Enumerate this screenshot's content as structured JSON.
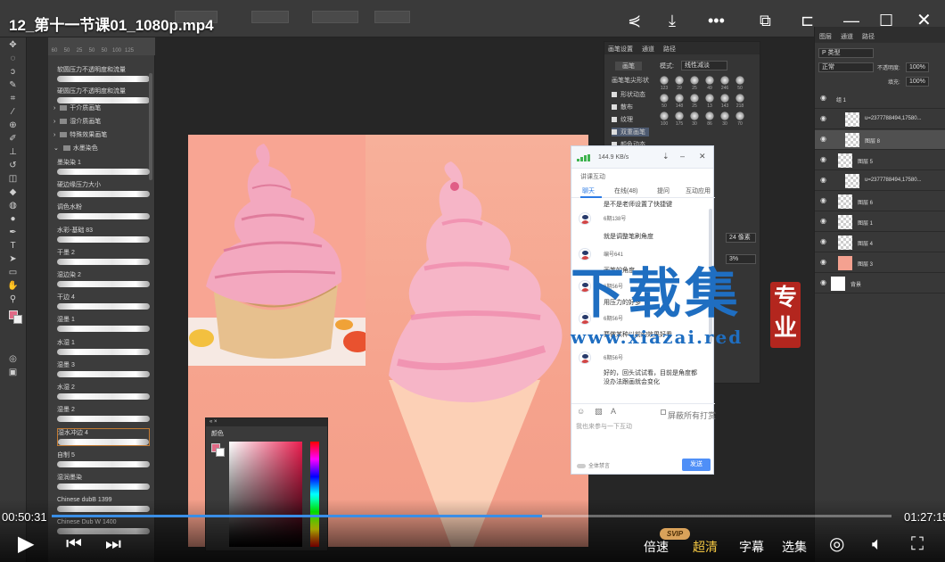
{
  "video": {
    "title": "12_第十一节课01_1080p.mp4",
    "current_time": "00:50:31",
    "total_time": "01:27:15",
    "progress": 0.584,
    "speed_label": "倍速",
    "quality_label": "超清",
    "subtitle_label": "字幕",
    "episodes_label": "选集",
    "svip_badge": "SVIP"
  },
  "photoshop": {
    "brush_sizes": [
      "60",
      "50",
      "25",
      "50",
      "50",
      "100",
      "125"
    ],
    "brushes": [
      {
        "name": "软圆压力不透明度和流量"
      },
      {
        "name": "硬圆压力不透明度和流量"
      }
    ],
    "folders": [
      {
        "name": "干介质画笔"
      },
      {
        "name": "湿介质画笔"
      },
      {
        "name": "特殊效果画笔"
      },
      {
        "name": "水墨染色"
      }
    ],
    "brush_list": [
      {
        "name": "墨染染 1"
      },
      {
        "name": "硬边缘压力大小"
      },
      {
        "name": "调色水粉"
      },
      {
        "name": "水彩-基础 83"
      },
      {
        "name": "干墨 2"
      },
      {
        "name": "湿边染 2"
      },
      {
        "name": "干边 4"
      },
      {
        "name": "湿墨 1"
      },
      {
        "name": "水湿 1"
      },
      {
        "name": "湿墨 3"
      },
      {
        "name": "水湿 2"
      },
      {
        "name": "湿墨 2"
      },
      {
        "name": "湿水冲边 4"
      },
      {
        "name": "自制 5"
      },
      {
        "name": "湿润墨染"
      },
      {
        "name": "Chinese dubB 1399"
      },
      {
        "name": "Chinese Dub W 1400"
      }
    ],
    "brush_settings": {
      "tabs": [
        "画笔设置",
        "通道",
        "路径"
      ],
      "preset_button": "画笔",
      "mode_label": "模式:",
      "mode_value": "线性减淡",
      "section_title": "画笔笔尖形状",
      "options": [
        "形状动态",
        "散布",
        "纹理",
        "双重画笔",
        "颜色动态"
      ],
      "tip_sizes": [
        "123",
        "29",
        "25",
        "49",
        "246",
        "50",
        "50",
        "148",
        "25",
        "13",
        "143",
        "218",
        "100",
        "175",
        "30",
        "86",
        "30",
        "70"
      ],
      "size_field": "24 像素",
      "spacing_field": "3%"
    },
    "layers": {
      "tabs": [
        "图层",
        "通道",
        "路径"
      ],
      "search": "P 类型",
      "blend": "正常",
      "opacity_label": "不透明度:",
      "opacity_value": "100%",
      "fill_label": "填充:",
      "fill_value": "100%",
      "items": [
        {
          "name": "组 1"
        },
        {
          "name": "u=2377788494,17580..."
        },
        {
          "name": "图层 8"
        },
        {
          "name": "图层 5"
        },
        {
          "name": "u=2377788494,17580..."
        },
        {
          "name": "图层 6"
        },
        {
          "name": "图层 1"
        },
        {
          "name": "图层 4"
        },
        {
          "name": "图层 3"
        },
        {
          "name": "背景"
        }
      ]
    },
    "color_panel": {
      "title": "颜色"
    },
    "colors": {
      "foreground": "#e06a86",
      "background": "#ffffff",
      "canvas": "#f6a38d"
    }
  },
  "chat": {
    "speed": "144.9 KB/s",
    "subtitle": "讲课互动",
    "tabs": [
      "聊天",
      "在线(48)",
      "提问",
      "互动应用"
    ],
    "messages": [
      {
        "user": "",
        "text": "是不是老师设置了快捷键"
      },
      {
        "user": "6期138号",
        "text": "就是调整笔刷角度"
      },
      {
        "user": "编号641",
        "text": "画笔的角度"
      },
      {
        "user": "6期56号",
        "text": "用压力的好多"
      },
      {
        "user": "6期56号",
        "text": "要做某种以前的效果好看"
      },
      {
        "user": "6期56号",
        "text": "好的，回头试试看，目前是角度都没办法跟画就会变化"
      }
    ],
    "shield_label": "屏蔽所有打赏",
    "input_placeholder": "我也来参与一下互动",
    "mute_label": "全体禁言",
    "send_label": "发送"
  },
  "watermark": {
    "title": "下载集",
    "url": "www.xiazai.red",
    "seal": "专业"
  }
}
